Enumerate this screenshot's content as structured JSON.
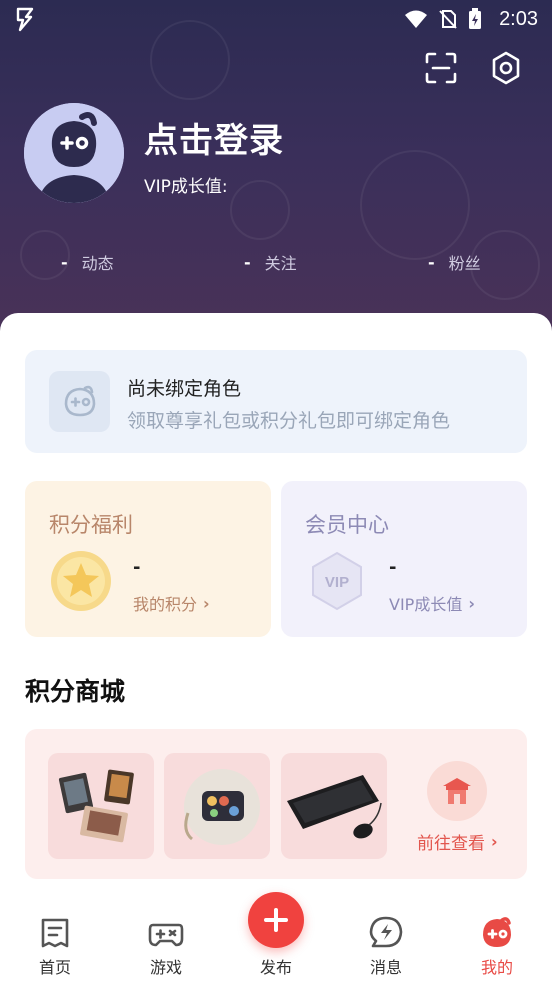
{
  "status_bar": {
    "time": "2:03"
  },
  "profile": {
    "login_prompt": "点击登录",
    "vip_growth_label": "VIP成长值:"
  },
  "stats": [
    {
      "value": "-",
      "label": "动态"
    },
    {
      "value": "-",
      "label": "关注"
    },
    {
      "value": "-",
      "label": "粉丝"
    }
  ],
  "bind_card": {
    "title": "尚未绑定角色",
    "subtitle": "领取尊享礼包或积分礼包即可绑定角色"
  },
  "points_card": {
    "title": "积分福利",
    "value": "-",
    "link_label": "我的积分"
  },
  "member_card": {
    "title": "会员中心",
    "value": "-",
    "link_label": "VIP成长值",
    "badge_text": "VIP"
  },
  "mall": {
    "title": "积分商城",
    "goto_label": "前往查看"
  },
  "bottom_nav": [
    {
      "label": "首页",
      "icon": "home-icon"
    },
    {
      "label": "游戏",
      "icon": "gamepad-icon"
    },
    {
      "label": "发布",
      "icon": "plus-icon"
    },
    {
      "label": "消息",
      "icon": "message-icon"
    },
    {
      "label": "我的",
      "icon": "mine-icon"
    }
  ],
  "colors": {
    "header_bg": "#2c2b52",
    "accent": "#f0423f",
    "points_bg": "#fdf3e4",
    "member_bg": "#f2f1fb",
    "bind_bg": "#eef3fb",
    "mall_bg": "#fdeeed"
  }
}
